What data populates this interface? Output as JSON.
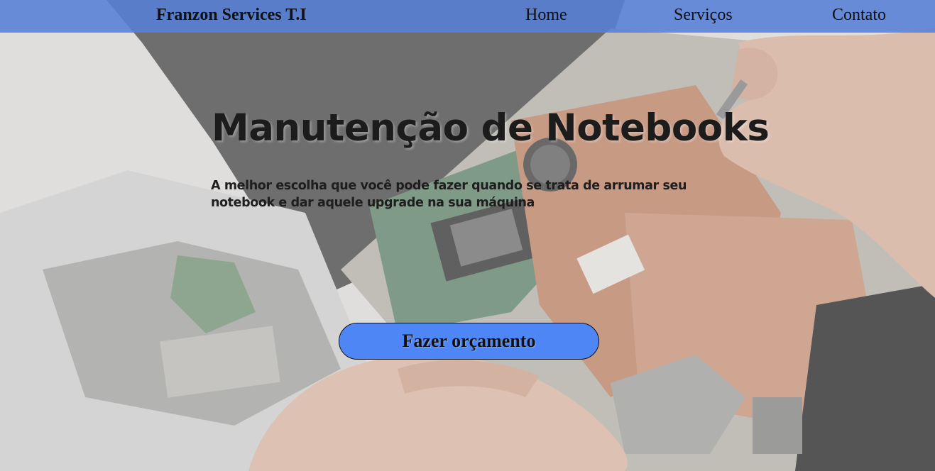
{
  "navbar": {
    "brand": "Franzon Services T.I",
    "links": [
      "Home",
      "Serviços",
      "Contato"
    ],
    "background_color": "#5680d6"
  },
  "hero": {
    "background_image": "laptop-repair-photo",
    "title": "Manutenção de Notebooks",
    "subtitle": "A melhor escolha que você pode fazer quando se trata de arrumar seu notebook e dar aquele upgrade na sua máquina",
    "cta_label": "Fazer orçamento",
    "cta_color": "#4f86f5"
  }
}
